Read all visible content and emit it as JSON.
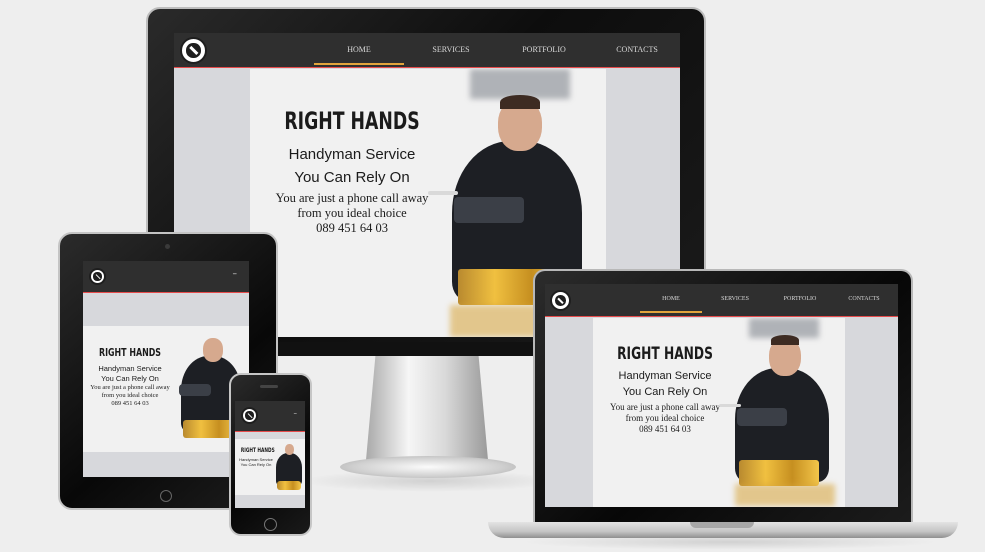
{
  "site": {
    "brand": "RIGHT HANDS",
    "nav": [
      "HOME",
      "SERVICES",
      "PORTFOLIO",
      "CONTACTS"
    ],
    "menu_toggle": "–",
    "hero": {
      "title": "RIGHT HANDS",
      "sub1": "Handyman Service",
      "sub2": "You Can Rely On",
      "body1": "You are just a phone call away",
      "body2": "from you ideal choice",
      "phone": "089 451 64 03"
    }
  },
  "colors": {
    "header": "#2f2f2f",
    "accent_underline": "#e2a43b",
    "header_border": "#e64b4b",
    "screen_bg": "#d7d8dc",
    "hero_bg": "#f1f1f1"
  },
  "icons": [
    "logo-icon",
    "menu-toggle-icon",
    "drill-icon"
  ]
}
